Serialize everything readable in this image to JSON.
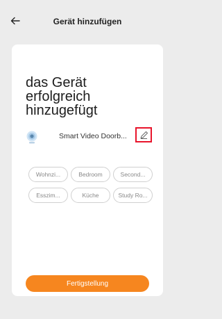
{
  "header": {
    "title": "Gerät hinzufügen",
    "back_icon": "arrow-left-icon"
  },
  "card": {
    "success_text": "das Gerät erfolgreich hinzugefügt",
    "device": {
      "icon": "camera-icon",
      "name": "Smart Video Doorb...",
      "edit_icon": "pencil-icon"
    },
    "rooms": [
      "Wohnzi...",
      "Bedroom",
      "Second...",
      "Esszim...",
      "Küche",
      "Study Ro..."
    ],
    "finish_label": "Fertigstellung"
  },
  "colors": {
    "accent": "#f6861f",
    "highlight": "#e8142b"
  }
}
